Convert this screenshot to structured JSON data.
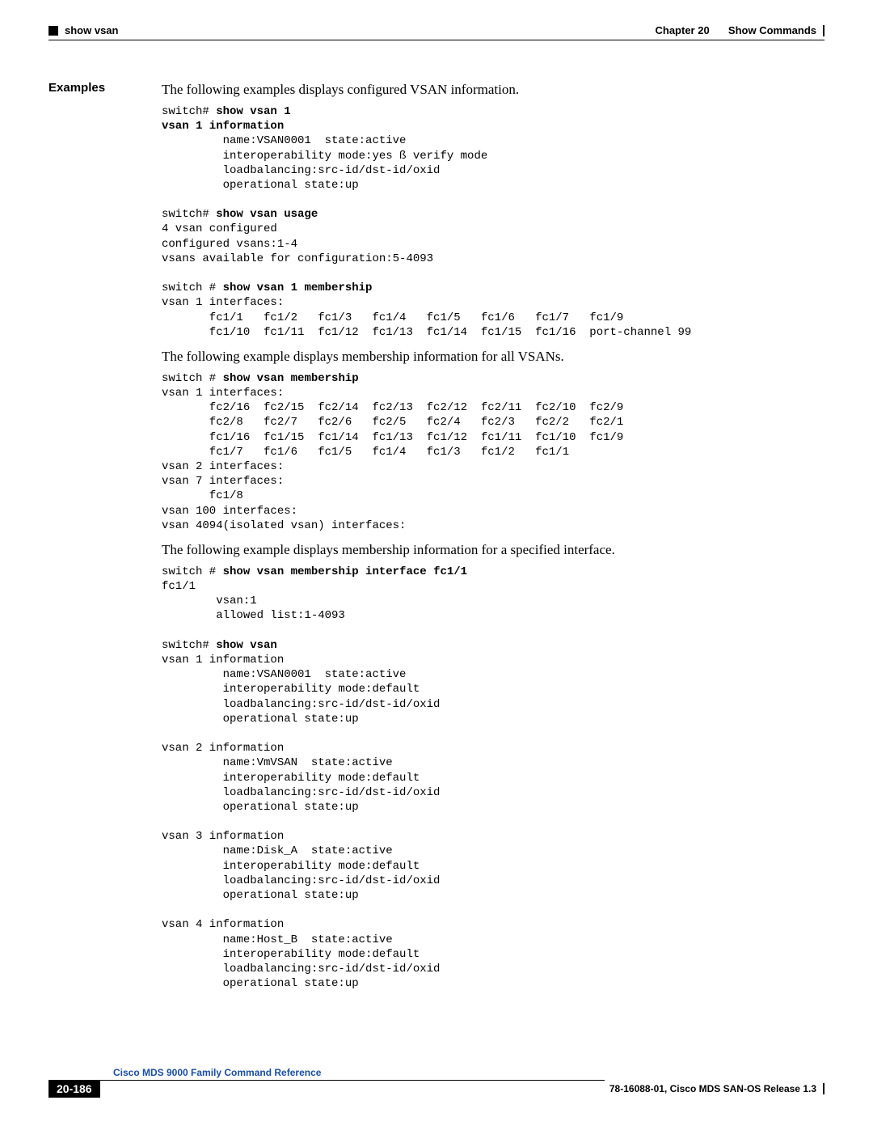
{
  "header": {
    "left": "show vsan",
    "chapter": "Chapter 20",
    "chapter_title": "Show Commands"
  },
  "section_label": "Examples",
  "intro1": "The following examples displays configured VSAN information.",
  "code1_prompt": "switch# ",
  "code1_cmd": "show vsan 1",
  "code1_line2": "vsan 1 information",
  "code1_body": "         name:VSAN0001  state:active\n         interoperability mode:yes ß verify mode\n         loadbalancing:src-id/dst-id/oxid\n         operational state:up\n",
  "code2_prompt": "switch# ",
  "code2_cmd": "show vsan usage",
  "code2_body": "4 vsan configured\nconfigured vsans:1-4\nvsans available for configuration:5-4093\n",
  "code3_prompt": "switch # ",
  "code3_cmd": "show vsan 1 membership",
  "code3_body": "vsan 1 interfaces:\n       fc1/1   fc1/2   fc1/3   fc1/4   fc1/5   fc1/6   fc1/7   fc1/9\n       fc1/10  fc1/11  fc1/12  fc1/13  fc1/14  fc1/15  fc1/16  port-channel 99",
  "intro2": "The following example displays membership information for all VSANs.",
  "code4_prompt": "switch # ",
  "code4_cmd": "show vsan membership",
  "code4_body": "vsan 1 interfaces:\n       fc2/16  fc2/15  fc2/14  fc2/13  fc2/12  fc2/11  fc2/10  fc2/9\n       fc2/8   fc2/7   fc2/6   fc2/5   fc2/4   fc2/3   fc2/2   fc2/1\n       fc1/16  fc1/15  fc1/14  fc1/13  fc1/12  fc1/11  fc1/10  fc1/9\n       fc1/7   fc1/6   fc1/5   fc1/4   fc1/3   fc1/2   fc1/1\nvsan 2 interfaces:\nvsan 7 interfaces:\n       fc1/8\nvsan 100 interfaces:\nvsan 4094(isolated vsan) interfaces:",
  "intro3": "The following example displays membership information for a specified interface.",
  "code5_prompt": "switch # ",
  "code5_cmd": "show vsan membership interface fc1/1",
  "code5_body": "fc1/1\n        vsan:1\n        allowed list:1-4093\n",
  "code6_prompt": "switch# ",
  "code6_cmd": "show vsan",
  "code6_body": "vsan 1 information\n         name:VSAN0001  state:active\n         interoperability mode:default\n         loadbalancing:src-id/dst-id/oxid\n         operational state:up\n\nvsan 2 information\n         name:VmVSAN  state:active\n         interoperability mode:default\n         loadbalancing:src-id/dst-id/oxid\n         operational state:up\n\nvsan 3 information\n         name:Disk_A  state:active\n         interoperability mode:default\n         loadbalancing:src-id/dst-id/oxid\n         operational state:up\n\nvsan 4 information\n         name:Host_B  state:active\n         interoperability mode:default\n         loadbalancing:src-id/dst-id/oxid\n         operational state:up",
  "footer": {
    "ref_title": "Cisco MDS 9000 Family Command Reference",
    "page_num": "20-186",
    "release": "78-16088-01, Cisco MDS SAN-OS Release 1.3"
  }
}
